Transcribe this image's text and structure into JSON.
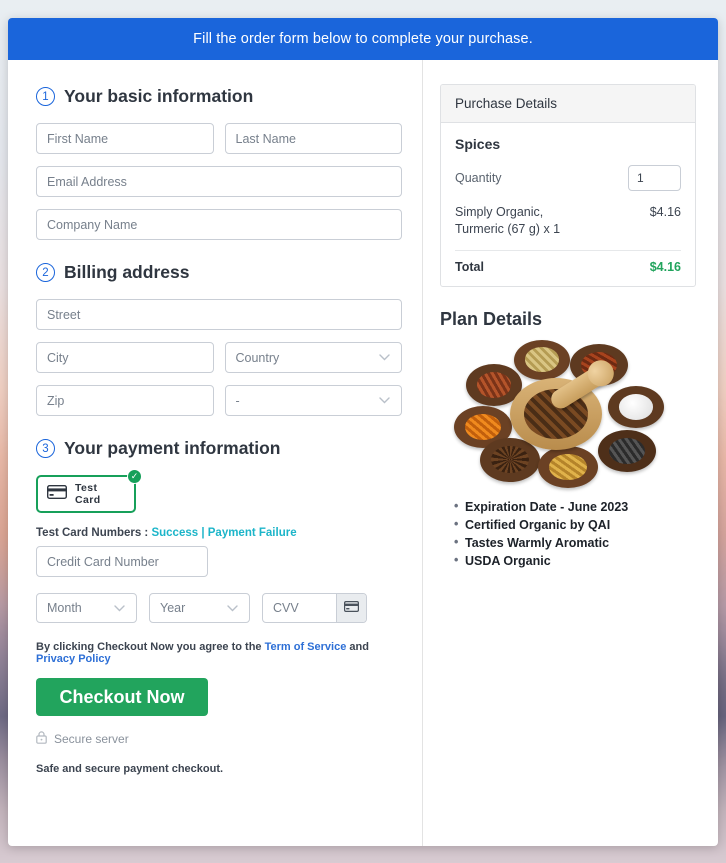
{
  "banner": {
    "text": "Fill the order form below to complete your purchase."
  },
  "steps": {
    "one": {
      "num": "1",
      "title": "Your basic information"
    },
    "two": {
      "num": "2",
      "title": "Billing address"
    },
    "three": {
      "num": "3",
      "title": "Your payment information"
    }
  },
  "basic": {
    "first_name_placeholder": "First Name",
    "last_name_placeholder": "Last Name",
    "email_placeholder": "Email Address",
    "company_placeholder": "Company Name"
  },
  "billing": {
    "street_placeholder": "Street",
    "city_placeholder": "City",
    "country_value": "Country",
    "zip_placeholder": "Zip",
    "state_value": "-"
  },
  "payment": {
    "tile_label": "Test  Card",
    "tile_icon": "credit-card-icon",
    "selected_badge": "✓",
    "test_prefix": "Test Card Numbers : ",
    "test_success": "Success",
    "test_separator": " | ",
    "test_failure": "Payment Failure",
    "card_number_placeholder": "Credit Card Number",
    "month_value": "Month",
    "year_value": "Year",
    "cvv_placeholder": "CVV",
    "cvv_icon": "credit-card-icon",
    "terms_prefix": "By clicking Checkout Now you agree to the ",
    "terms_link": "Term of Service",
    "terms_mid": " and ",
    "privacy_link": "Privacy Policy",
    "checkout_label": "Checkout Now",
    "secure_icon": "lock-icon",
    "secure_label": "Secure server",
    "safe_note": "Safe and secure payment checkout."
  },
  "purchase": {
    "header": "Purchase Details",
    "product_title": "Spices",
    "quantity_label": "Quantity",
    "quantity_value": "1",
    "item_name": "Simply Organic, Turmeric (67 g) x 1",
    "item_price": "$4.16",
    "total_label": "Total",
    "total_value": "$4.16"
  },
  "plan": {
    "title": "Plan Details",
    "image_alt": "spice-bowls-photo",
    "bullets": [
      "Expiration Date - June 2023",
      "Certified Organic by QAI",
      "Tastes Warmly Aromatic",
      "USDA Organic"
    ]
  },
  "colors": {
    "banner_blue": "#1a65db",
    "accent_green": "#22a45d",
    "link_blue": "#2d6fd6",
    "link_teal": "#1cb5c9"
  }
}
